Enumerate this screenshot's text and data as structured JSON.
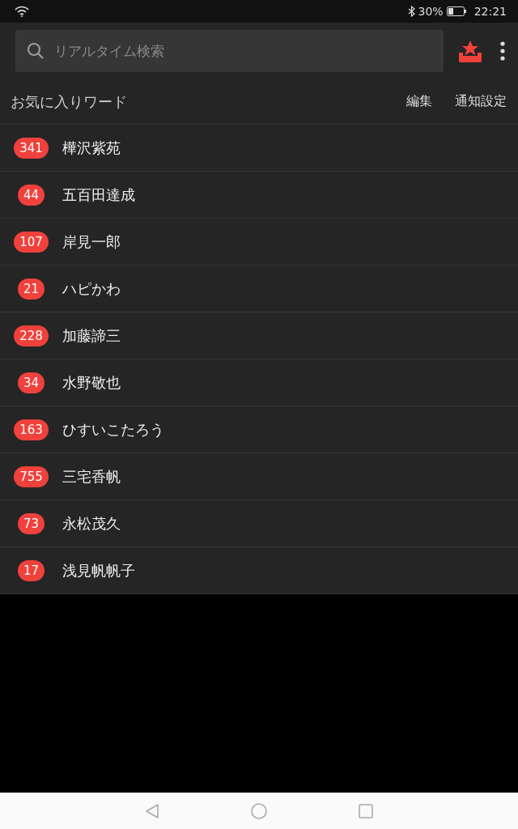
{
  "status_bar": {
    "battery": "30%",
    "time": "22:21"
  },
  "search": {
    "placeholder": "リアルタイム検索"
  },
  "section": {
    "title": "お気に入りワード",
    "actions": [
      "編集",
      "通知設定"
    ]
  },
  "words": [
    {
      "count": "341",
      "name": "樺沢紫苑"
    },
    {
      "count": "44",
      "name": "五百田達成"
    },
    {
      "count": "107",
      "name": "岸見一郎"
    },
    {
      "count": "21",
      "name": "ハピかわ"
    },
    {
      "count": "228",
      "name": "加藤諦三"
    },
    {
      "count": "34",
      "name": "水野敬也"
    },
    {
      "count": "163",
      "name": "ひすいこたろう"
    },
    {
      "count": "755",
      "name": "三宅香帆"
    },
    {
      "count": "73",
      "name": "永松茂久"
    },
    {
      "count": "17",
      "name": "浅見帆帆子"
    }
  ]
}
